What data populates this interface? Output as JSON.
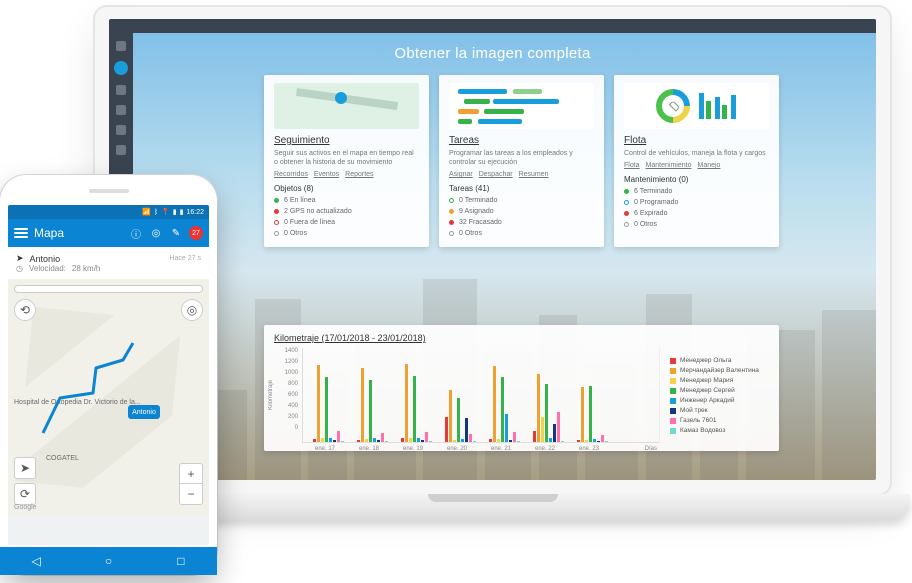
{
  "laptop": {
    "page_title": "Obtener la imagen completa",
    "card_tracking": {
      "title": "Seguimiento",
      "desc": "Seguir sus activos en el mapa en tiempo real o obtener la historia de su movimiento",
      "links": [
        "Recorridos",
        "Eventos",
        "Reportes"
      ],
      "group": "Objetos (8)",
      "stats": [
        {
          "label": "6 En línea",
          "color": "#36b24a",
          "fill": true
        },
        {
          "label": "2 GPS no actualizado",
          "color": "#e33a3a",
          "fill": true
        },
        {
          "label": "0 Fuera de línea",
          "color": "#e33a3a",
          "fill": false
        },
        {
          "label": "0 Otros",
          "color": "#9b9b9b",
          "fill": false
        }
      ]
    },
    "card_tasks": {
      "title": "Tareas",
      "desc": "Programar las tareas a los empleados y controlar su ejecución",
      "links": [
        "Asignar",
        "Despachar",
        "Resumen"
      ],
      "group": "Tareas (41)",
      "stats": [
        {
          "label": "0 Terminado",
          "color": "#36b24a",
          "fill": false
        },
        {
          "label": "9 Asignado",
          "color": "#f0a030",
          "fill": true
        },
        {
          "label": "32 Fracasado",
          "color": "#e33a3a",
          "fill": true
        },
        {
          "label": "0 Otros",
          "color": "#9b9b9b",
          "fill": false
        }
      ]
    },
    "card_fleet": {
      "title": "Flota",
      "desc": "Control de vehículos, maneja la flota y cargos",
      "links": [
        "Flota",
        "Mantenimiento",
        "Manejo"
      ],
      "group": "Mantenimiento (0)",
      "stats": [
        {
          "label": "6 Terminado",
          "color": "#36b24a",
          "fill": true
        },
        {
          "label": "0 Programado",
          "color": "#199edc",
          "fill": false
        },
        {
          "label": "6 Expirado",
          "color": "#e33a3a",
          "fill": true
        },
        {
          "label": "0 Otros",
          "color": "#9b9b9b",
          "fill": false
        }
      ]
    },
    "chart_title": "Kilometraje (17/01/2018 - 23/01/2018)",
    "chart_days_lbl": "Días",
    "chart_axis_lbl": "Kilometraje"
  },
  "chart_data": {
    "type": "bar",
    "title": "Kilometraje (17/01/2018 - 23/01/2018)",
    "xlabel": "Días",
    "ylabel": "Kilometraje",
    "ylim": [
      0,
      1400
    ],
    "yticks": [
      0,
      200,
      400,
      600,
      800,
      1000,
      1200,
      1400
    ],
    "categories": [
      "ene. 17",
      "ene. 18",
      "ene. 19",
      "ene. 20",
      "ene. 21",
      "ene. 22",
      "ene. 23"
    ],
    "series": [
      {
        "name": "Менеджер Ольга",
        "color": "#e33a3a",
        "values": [
          50,
          40,
          60,
          420,
          50,
          180,
          40
        ]
      },
      {
        "name": "Мерчандайзер Валентина",
        "color": "#f0a030",
        "values": [
          1300,
          1250,
          1320,
          880,
          1280,
          1150,
          920
        ]
      },
      {
        "name": "Менеджер Мария",
        "color": "#f0d24b",
        "values": [
          60,
          50,
          70,
          40,
          55,
          430,
          30
        ]
      },
      {
        "name": "Менеджер Сергей",
        "color": "#36b24a",
        "values": [
          1100,
          1040,
          1120,
          750,
          1090,
          980,
          940
        ]
      },
      {
        "name": "Инженер Аркадий",
        "color": "#199edc",
        "values": [
          70,
          60,
          65,
          55,
          480,
          60,
          45
        ]
      },
      {
        "name": "Мой трек",
        "color": "#14387f",
        "values": [
          40,
          35,
          30,
          410,
          35,
          300,
          25
        ]
      },
      {
        "name": "Газель 7601",
        "color": "#ff6fb0",
        "values": [
          180,
          160,
          170,
          130,
          165,
          500,
          120
        ]
      },
      {
        "name": "Камаз Водовоз",
        "color": "#6fd9d4",
        "values": [
          25,
          20,
          22,
          18,
          20,
          22,
          16
        ]
      }
    ]
  },
  "phone": {
    "status": {
      "time": "16:22"
    },
    "appbar": {
      "title": "Mapa",
      "badge": "27"
    },
    "tracker": {
      "name": "Antonio",
      "ago": "Hace 27 s",
      "speed_label": "Velocidad:",
      "speed_value": "28 km/h"
    },
    "map": {
      "hospital_lbl": "Hospital de Ortopedia\nDr. Victorio de la...",
      "cogatel_lbl": "COGATEL",
      "marker_lbl": "Antonio",
      "google_lbl": "Google"
    }
  }
}
